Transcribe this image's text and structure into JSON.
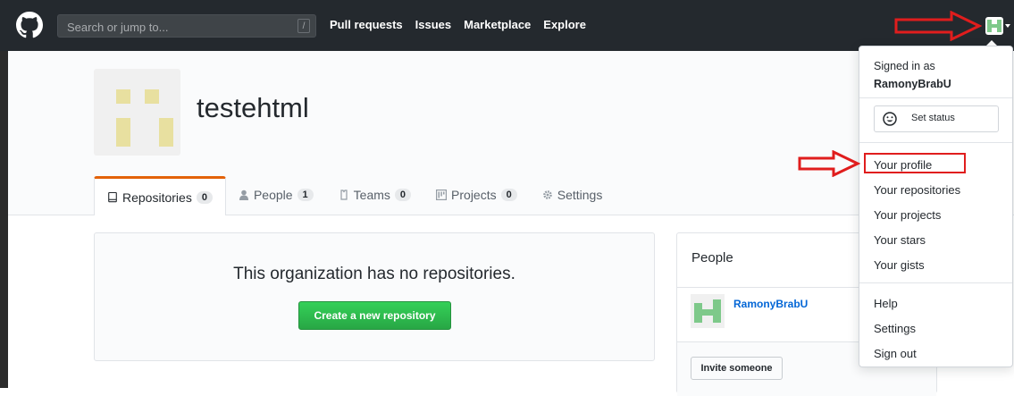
{
  "header": {
    "search_placeholder": "Search or jump to...",
    "search_shortcut": "/",
    "nav": [
      "Pull requests",
      "Issues",
      "Marketplace",
      "Explore"
    ]
  },
  "org": {
    "name": "testehtml"
  },
  "tabs": [
    {
      "label": "Repositories",
      "count": "0",
      "icon": "repo-icon",
      "selected": true
    },
    {
      "label": "People",
      "count": "1",
      "icon": "person-icon"
    },
    {
      "label": "Teams",
      "count": "0",
      "icon": "jersey-icon"
    },
    {
      "label": "Projects",
      "count": "0",
      "icon": "project-icon"
    },
    {
      "label": "Settings",
      "icon": "gear-icon"
    }
  ],
  "main": {
    "blankslate_title": "This organization has no repositories.",
    "create_button": "Create a new repository"
  },
  "people_box": {
    "title": "People",
    "member": "RamonyBrabU",
    "invite_button": "Invite someone"
  },
  "dropdown": {
    "signed_in_as": "Signed in as",
    "username": "RamonyBrabU",
    "set_status": "Set status",
    "items_group1": [
      "Your profile",
      "Your repositories",
      "Your projects",
      "Your stars",
      "Your gists"
    ],
    "items_group2": [
      "Help",
      "Settings",
      "Sign out"
    ]
  },
  "colors": {
    "header_bg": "#24292e",
    "accent_tab": "#e36209",
    "button_green": "#28a745",
    "annotation_red": "#e01d1d",
    "link_blue": "#0366d6"
  }
}
